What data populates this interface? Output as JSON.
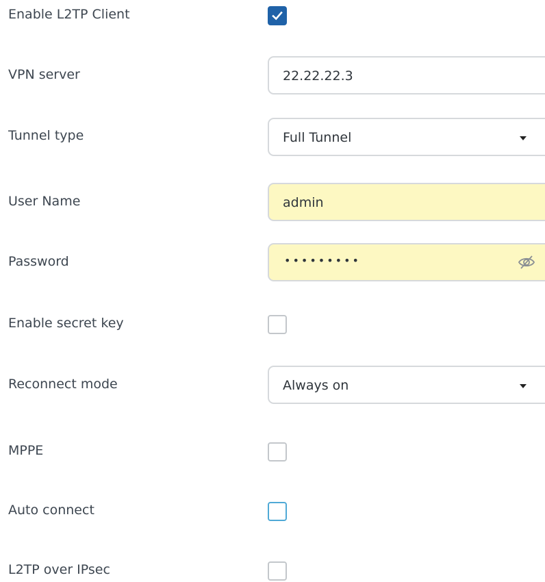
{
  "form": {
    "enable_l2tp_client": {
      "label": "Enable L2TP Client",
      "checked": true
    },
    "vpn_server": {
      "label": "VPN server",
      "value": "22.22.22.3"
    },
    "tunnel_type": {
      "label": "Tunnel type",
      "selected": "Full Tunnel"
    },
    "user_name": {
      "label": "User Name",
      "value": "admin"
    },
    "password": {
      "label": "Password",
      "masked": "•••••••••",
      "toggle_icon": "eye-slash-icon"
    },
    "enable_secret_key": {
      "label": "Enable secret key",
      "checked": false
    },
    "reconnect_mode": {
      "label": "Reconnect mode",
      "selected": "Always on"
    },
    "mppe": {
      "label": "MPPE",
      "checked": false
    },
    "auto_connect": {
      "label": "Auto connect",
      "checked": false,
      "focused": true
    },
    "l2tp_over_ipsec": {
      "label": "L2TP over IPsec",
      "checked": false
    }
  },
  "colors": {
    "label_text": "#3d4650",
    "checkbox_checked": "#1f62a8",
    "checkbox_border": "#c3c7cb",
    "checkbox_focus": "#4fa9d6",
    "field_border": "#d6d9dc",
    "autofill_bg": "#fdf8c2"
  }
}
